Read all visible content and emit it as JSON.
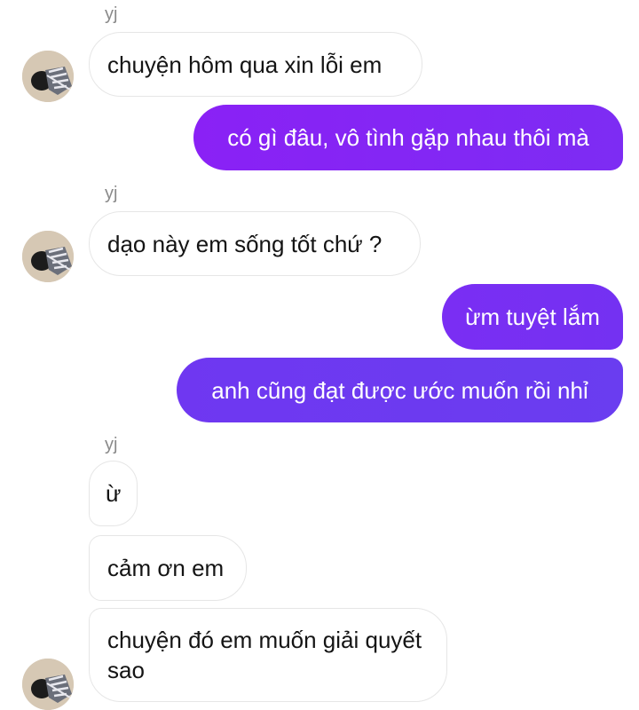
{
  "chat": {
    "sender_1": "yj",
    "sender_2": "yj",
    "sender_3": "yj",
    "messages": [
      {
        "side": "in",
        "text": "chuyện hôm qua xin lỗi em"
      },
      {
        "side": "out",
        "text": "có gì đâu, vô tình gặp nhau thôi mà"
      },
      {
        "side": "in",
        "text": "dạo này em sống tốt chứ ?"
      },
      {
        "side": "out",
        "text": "ừm tuyệt lắm"
      },
      {
        "side": "out",
        "text": "anh cũng đạt được ước muốn rồi nhỉ"
      },
      {
        "side": "in",
        "text": "ừ"
      },
      {
        "side": "in",
        "text": "cảm ơn em"
      },
      {
        "side": "in",
        "text": "chuyện đó em muốn giải quyết sao"
      }
    ]
  },
  "colors": {
    "outgoing_gradient_start": "#8a21f5",
    "outgoing_gradient_end": "#6a3df0",
    "incoming_bg": "#ffffff",
    "incoming_border": "#e6e6e6",
    "sender_name": "#8a8a8a"
  },
  "avatar": {
    "icon": "user-photo-icon"
  }
}
